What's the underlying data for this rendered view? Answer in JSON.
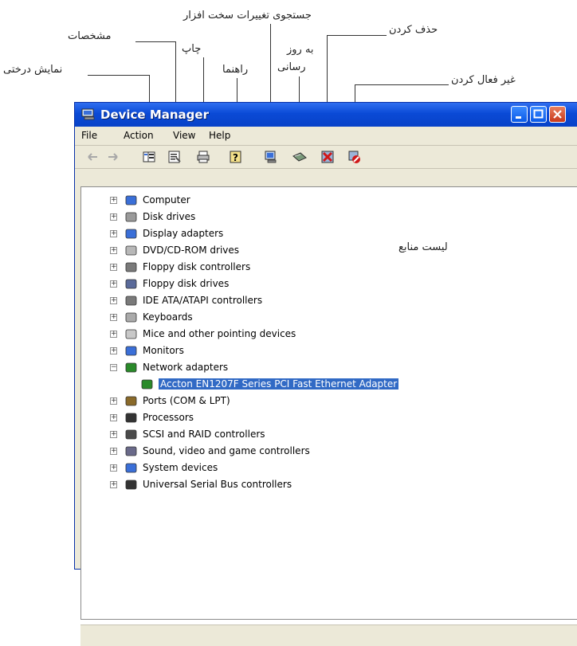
{
  "annotations": {
    "tree_view": "نمایش درختی",
    "properties": "مشخصات",
    "print": "چاپ",
    "help": "راهنما",
    "scan": "جستجوی تغییرات سخت افزار",
    "update_line1": "به روز",
    "update_line2": "رسانی",
    "uninstall": "حذف کردن",
    "disable": "غیر فعال کردن",
    "resource_list": "لیست منابع"
  },
  "window": {
    "title": "Device Manager",
    "menu": [
      "File",
      "Action",
      "View",
      "Help"
    ]
  },
  "tree": {
    "nodes": [
      {
        "label": "Computer",
        "icon": "computer-icon",
        "expander": "+"
      },
      {
        "label": "Disk drives",
        "icon": "disk-drive-icon",
        "expander": "+"
      },
      {
        "label": "Display adapters",
        "icon": "display-adapter-icon",
        "expander": "+"
      },
      {
        "label": "DVD/CD-ROM drives",
        "icon": "cd-rom-icon",
        "expander": "+"
      },
      {
        "label": "Floppy disk controllers",
        "icon": "floppy-controller-icon",
        "expander": "+"
      },
      {
        "label": "Floppy disk drives",
        "icon": "floppy-drive-icon",
        "expander": "+"
      },
      {
        "label": "IDE ATA/ATAPI controllers",
        "icon": "ide-controller-icon",
        "expander": "+"
      },
      {
        "label": "Keyboards",
        "icon": "keyboard-icon",
        "expander": "+"
      },
      {
        "label": "Mice and other pointing devices",
        "icon": "mouse-icon",
        "expander": "+"
      },
      {
        "label": "Monitors",
        "icon": "monitor-icon",
        "expander": "+"
      },
      {
        "label": "Network adapters",
        "icon": "network-adapter-icon",
        "expander": "−"
      },
      {
        "label": "Accton EN1207F Series PCI Fast Ethernet Adapter",
        "icon": "network-card-icon",
        "expander": "",
        "child": true
      },
      {
        "label": "Ports (COM & LPT)",
        "icon": "port-icon",
        "expander": "+"
      },
      {
        "label": "Processors",
        "icon": "processor-icon",
        "expander": "+"
      },
      {
        "label": "SCSI and RAID controllers",
        "icon": "scsi-icon",
        "expander": "+"
      },
      {
        "label": "Sound, video and game controllers",
        "icon": "sound-icon",
        "expander": "+"
      },
      {
        "label": "System devices",
        "icon": "system-device-icon",
        "expander": "+"
      },
      {
        "label": "Universal Serial Bus controllers",
        "icon": "usb-icon",
        "expander": "+"
      }
    ]
  },
  "colors": {
    "titlebar": "#0a4ad6",
    "selection": "#316ac5",
    "chrome": "#ece9d8"
  }
}
